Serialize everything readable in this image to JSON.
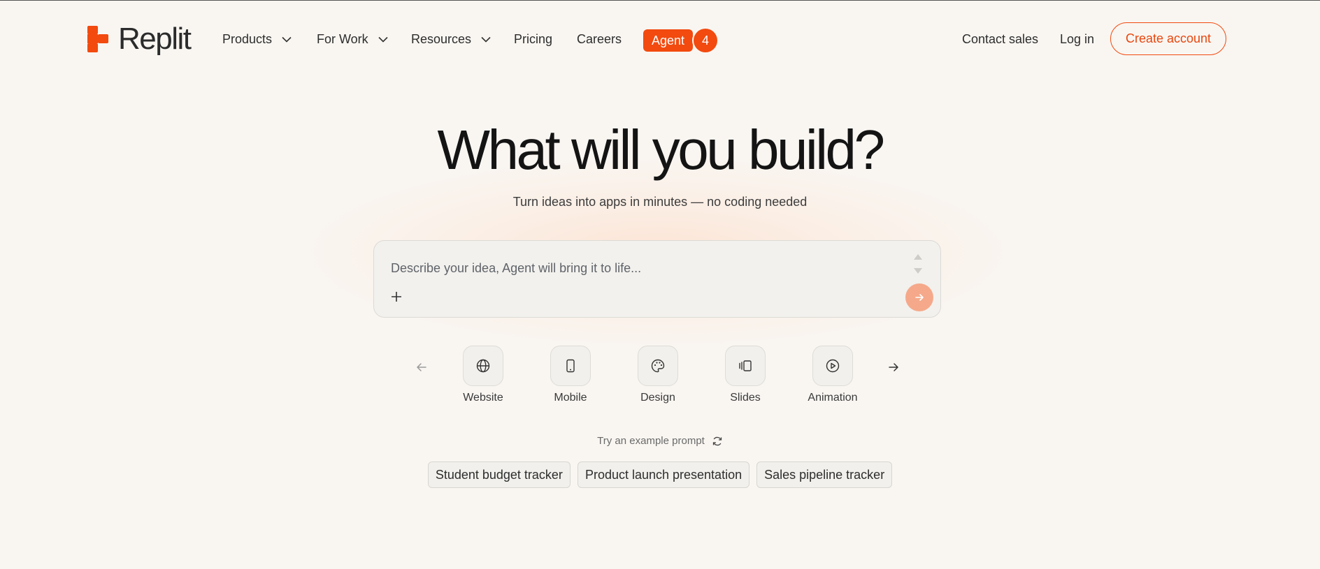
{
  "nav": {
    "brand": "Replit",
    "items": [
      {
        "label": "Products",
        "dropdown": true
      },
      {
        "label": "For Work",
        "dropdown": true
      },
      {
        "label": "Resources",
        "dropdown": true
      },
      {
        "label": "Pricing",
        "dropdown": false
      },
      {
        "label": "Careers",
        "dropdown": false
      }
    ],
    "agent_label": "Agent",
    "agent_badge": "4",
    "contact_sales": "Contact sales",
    "login": "Log in",
    "create_account": "Create account"
  },
  "hero": {
    "title": "What will you build?",
    "subtitle": "Turn ideas into apps in minutes — no coding needed"
  },
  "prompt": {
    "placeholder": "Describe your idea, Agent will bring it to life..."
  },
  "categories": [
    {
      "label": "Website",
      "icon": "globe-icon"
    },
    {
      "label": "Mobile",
      "icon": "mobile-icon"
    },
    {
      "label": "Design",
      "icon": "palette-icon"
    },
    {
      "label": "Slides",
      "icon": "slides-icon"
    },
    {
      "label": "Animation",
      "icon": "play-icon"
    }
  ],
  "examples": {
    "label": "Try an example prompt",
    "chips": [
      "Student budget tracker",
      "Product launch presentation",
      "Sales pipeline tracker"
    ]
  },
  "colors": {
    "accent": "#f24a0f",
    "background": "#f9f6f2",
    "send_button": "#f5a98a"
  }
}
